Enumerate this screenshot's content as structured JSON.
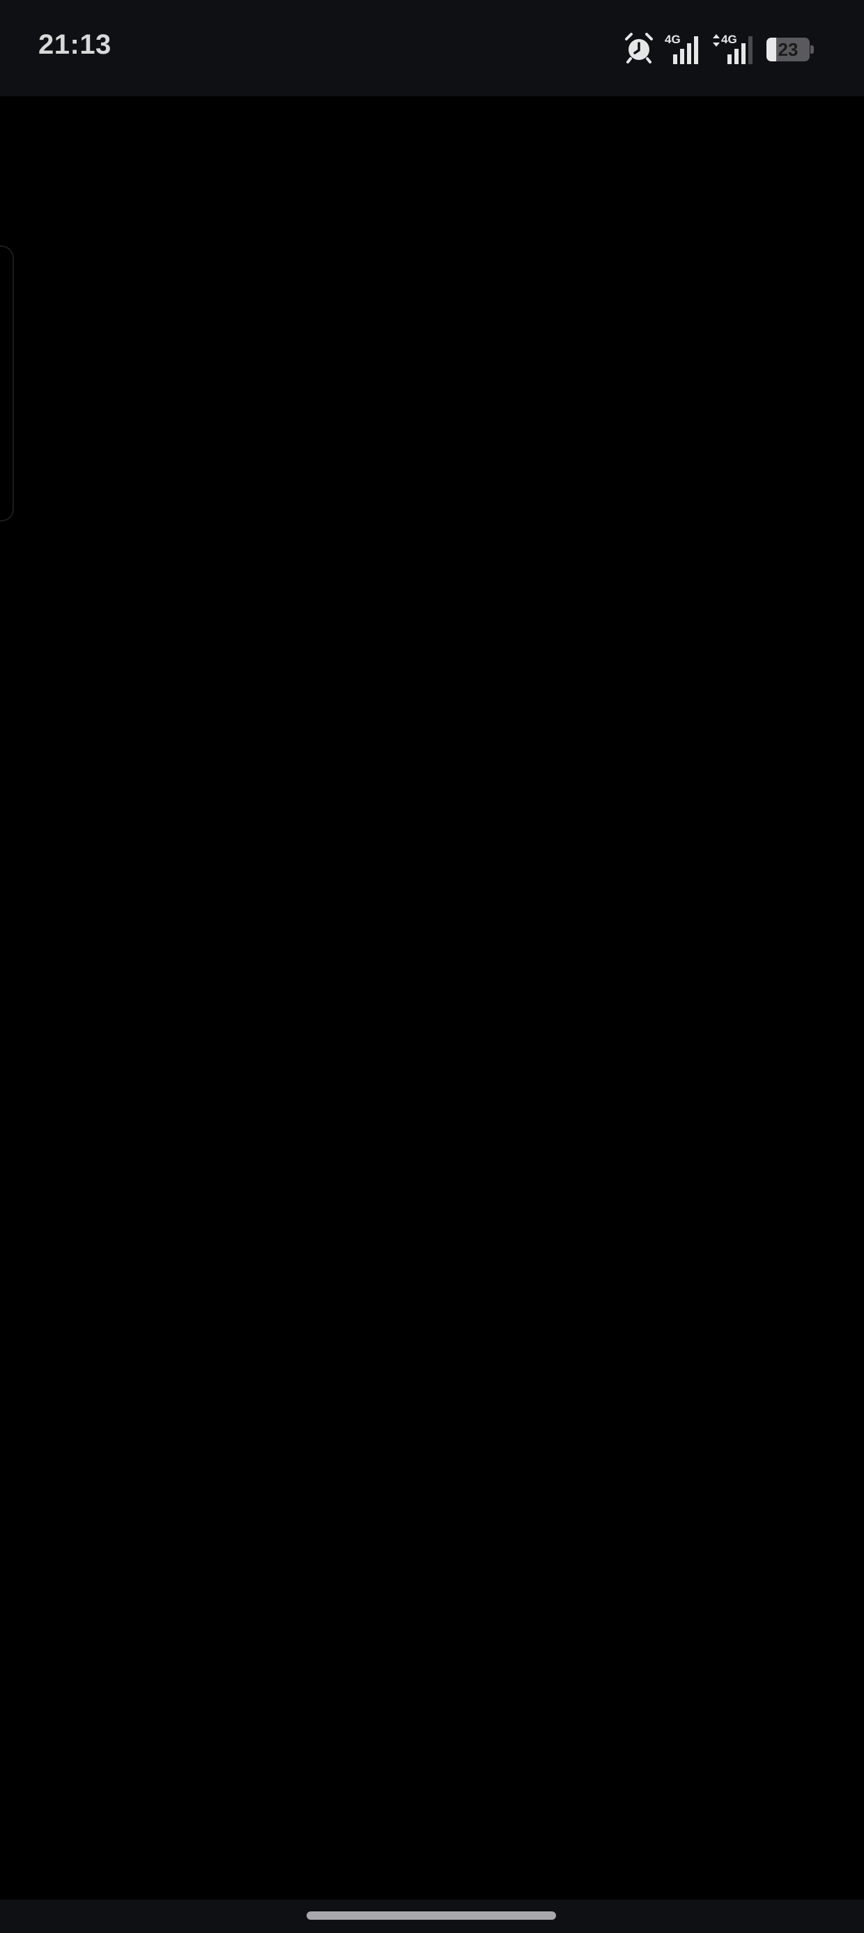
{
  "status_bar": {
    "time": "21:13",
    "icons": [
      "alarm-icon",
      "signal-icon",
      "signal-icon"
    ],
    "sim1": {
      "network": "4G",
      "signal_bars": 4
    },
    "sim2": {
      "network": "4G",
      "signal_bars": 3,
      "data_activity": true
    },
    "battery": {
      "level": "23",
      "fraction": 0.23
    }
  },
  "colors": {
    "background": "#000000",
    "bars": "#0f1014",
    "text": "#d8d8d8",
    "home_indicator": "#a9a9ad"
  }
}
